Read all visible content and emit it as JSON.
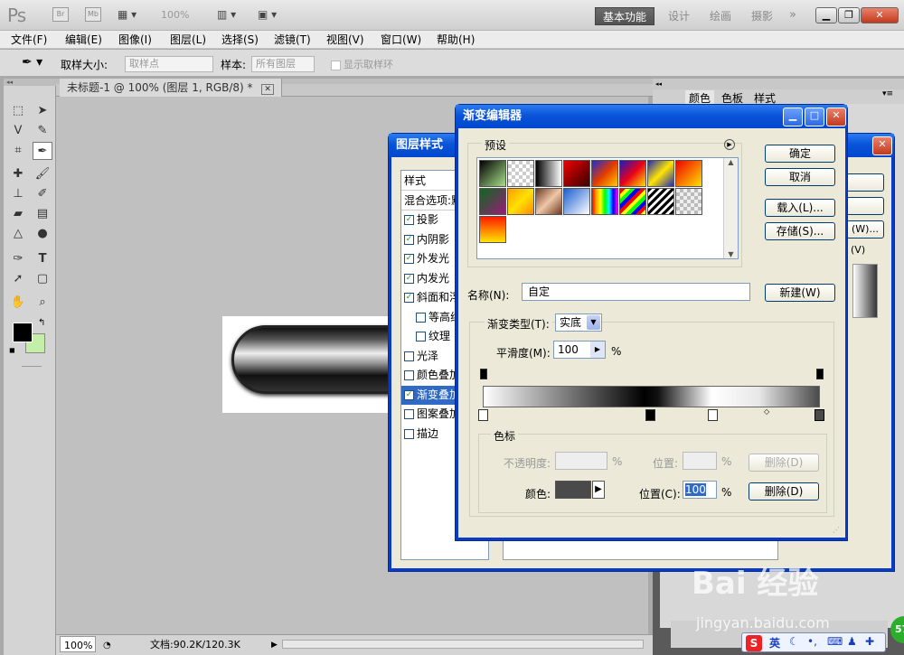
{
  "app": {
    "logo": "Ps",
    "zoom": "100%"
  },
  "workspaces": [
    "基本功能",
    "设计",
    "绘画",
    "摄影"
  ],
  "menu": [
    "文件(F)",
    "编辑(E)",
    "图像(I)",
    "图层(L)",
    "选择(S)",
    "滤镜(T)",
    "视图(V)",
    "窗口(W)",
    "帮助(H)"
  ],
  "options": {
    "sample_size_label": "取样大小:",
    "sample_size_value": "取样点",
    "sample_label": "样本:",
    "sample_value": "所有图层",
    "show_ring": "显示取样环"
  },
  "document": {
    "tab": "未标题-1 @ 100% (图层 1, RGB/8) *",
    "zoom": "100%",
    "file_info": "文档:90.2K/120.3K"
  },
  "right_panel": {
    "tabs": [
      "颜色",
      "色板",
      "样式"
    ]
  },
  "layer_style": {
    "title": "图层样式",
    "header": "样式",
    "blend_options": "混合选项:默",
    "items": [
      {
        "label": "投影",
        "checked": true
      },
      {
        "label": "内阴影",
        "checked": true
      },
      {
        "label": "外发光",
        "checked": true
      },
      {
        "label": "内发光",
        "checked": true
      },
      {
        "label": "斜面和浮",
        "checked": true
      },
      {
        "label": "等高线",
        "checked": false
      },
      {
        "label": "纹理",
        "checked": false
      },
      {
        "label": "光泽",
        "checked": false
      },
      {
        "label": "颜色叠加",
        "checked": false
      },
      {
        "label": "渐变叠加",
        "checked": true
      },
      {
        "label": "图案叠加",
        "checked": false
      },
      {
        "label": "描边",
        "checked": false
      }
    ],
    "buttons_right": [
      "(W)...",
      "(V)"
    ]
  },
  "gradient_editor": {
    "title": "渐变编辑器",
    "presets_label": "预设",
    "buttons": {
      "ok": "确定",
      "cancel": "取消",
      "load": "载入(L)...",
      "save": "存储(S)...",
      "new": "新建(W)"
    },
    "name_label": "名称(N):",
    "name_value": "自定",
    "type_label": "渐变类型(T):",
    "type_value": "实底",
    "smooth_label": "平滑度(M):",
    "smooth_value": "100",
    "percent": "%",
    "stops_group": "色标",
    "opacity_label": "不透明度:",
    "position_label1": "位置:",
    "delete1": "删除(D)",
    "color_label": "颜色:",
    "position_label2": "位置(C):",
    "position_value": "100",
    "delete2": "删除(D)",
    "swatch_color": "#4a4a4a"
  },
  "watermark": {
    "brand": "Bai  经验",
    "url": "jingyan.baidu.com"
  },
  "taskbar": {
    "ime": "英",
    "badge": "57"
  }
}
